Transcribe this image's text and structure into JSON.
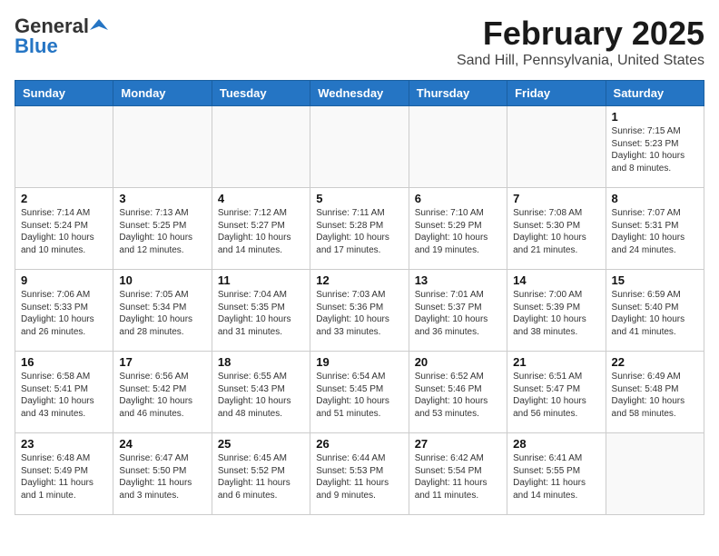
{
  "header": {
    "logo_general": "General",
    "logo_blue": "Blue",
    "title": "February 2025",
    "subtitle": "Sand Hill, Pennsylvania, United States"
  },
  "weekdays": [
    "Sunday",
    "Monday",
    "Tuesday",
    "Wednesday",
    "Thursday",
    "Friday",
    "Saturday"
  ],
  "weeks": [
    [
      {
        "day": "",
        "info": ""
      },
      {
        "day": "",
        "info": ""
      },
      {
        "day": "",
        "info": ""
      },
      {
        "day": "",
        "info": ""
      },
      {
        "day": "",
        "info": ""
      },
      {
        "day": "",
        "info": ""
      },
      {
        "day": "1",
        "info": "Sunrise: 7:15 AM\nSunset: 5:23 PM\nDaylight: 10 hours\nand 8 minutes."
      }
    ],
    [
      {
        "day": "2",
        "info": "Sunrise: 7:14 AM\nSunset: 5:24 PM\nDaylight: 10 hours\nand 10 minutes."
      },
      {
        "day": "3",
        "info": "Sunrise: 7:13 AM\nSunset: 5:25 PM\nDaylight: 10 hours\nand 12 minutes."
      },
      {
        "day": "4",
        "info": "Sunrise: 7:12 AM\nSunset: 5:27 PM\nDaylight: 10 hours\nand 14 minutes."
      },
      {
        "day": "5",
        "info": "Sunrise: 7:11 AM\nSunset: 5:28 PM\nDaylight: 10 hours\nand 17 minutes."
      },
      {
        "day": "6",
        "info": "Sunrise: 7:10 AM\nSunset: 5:29 PM\nDaylight: 10 hours\nand 19 minutes."
      },
      {
        "day": "7",
        "info": "Sunrise: 7:08 AM\nSunset: 5:30 PM\nDaylight: 10 hours\nand 21 minutes."
      },
      {
        "day": "8",
        "info": "Sunrise: 7:07 AM\nSunset: 5:31 PM\nDaylight: 10 hours\nand 24 minutes."
      }
    ],
    [
      {
        "day": "9",
        "info": "Sunrise: 7:06 AM\nSunset: 5:33 PM\nDaylight: 10 hours\nand 26 minutes."
      },
      {
        "day": "10",
        "info": "Sunrise: 7:05 AM\nSunset: 5:34 PM\nDaylight: 10 hours\nand 28 minutes."
      },
      {
        "day": "11",
        "info": "Sunrise: 7:04 AM\nSunset: 5:35 PM\nDaylight: 10 hours\nand 31 minutes."
      },
      {
        "day": "12",
        "info": "Sunrise: 7:03 AM\nSunset: 5:36 PM\nDaylight: 10 hours\nand 33 minutes."
      },
      {
        "day": "13",
        "info": "Sunrise: 7:01 AM\nSunset: 5:37 PM\nDaylight: 10 hours\nand 36 minutes."
      },
      {
        "day": "14",
        "info": "Sunrise: 7:00 AM\nSunset: 5:39 PM\nDaylight: 10 hours\nand 38 minutes."
      },
      {
        "day": "15",
        "info": "Sunrise: 6:59 AM\nSunset: 5:40 PM\nDaylight: 10 hours\nand 41 minutes."
      }
    ],
    [
      {
        "day": "16",
        "info": "Sunrise: 6:58 AM\nSunset: 5:41 PM\nDaylight: 10 hours\nand 43 minutes."
      },
      {
        "day": "17",
        "info": "Sunrise: 6:56 AM\nSunset: 5:42 PM\nDaylight: 10 hours\nand 46 minutes."
      },
      {
        "day": "18",
        "info": "Sunrise: 6:55 AM\nSunset: 5:43 PM\nDaylight: 10 hours\nand 48 minutes."
      },
      {
        "day": "19",
        "info": "Sunrise: 6:54 AM\nSunset: 5:45 PM\nDaylight: 10 hours\nand 51 minutes."
      },
      {
        "day": "20",
        "info": "Sunrise: 6:52 AM\nSunset: 5:46 PM\nDaylight: 10 hours\nand 53 minutes."
      },
      {
        "day": "21",
        "info": "Sunrise: 6:51 AM\nSunset: 5:47 PM\nDaylight: 10 hours\nand 56 minutes."
      },
      {
        "day": "22",
        "info": "Sunrise: 6:49 AM\nSunset: 5:48 PM\nDaylight: 10 hours\nand 58 minutes."
      }
    ],
    [
      {
        "day": "23",
        "info": "Sunrise: 6:48 AM\nSunset: 5:49 PM\nDaylight: 11 hours\nand 1 minute."
      },
      {
        "day": "24",
        "info": "Sunrise: 6:47 AM\nSunset: 5:50 PM\nDaylight: 11 hours\nand 3 minutes."
      },
      {
        "day": "25",
        "info": "Sunrise: 6:45 AM\nSunset: 5:52 PM\nDaylight: 11 hours\nand 6 minutes."
      },
      {
        "day": "26",
        "info": "Sunrise: 6:44 AM\nSunset: 5:53 PM\nDaylight: 11 hours\nand 9 minutes."
      },
      {
        "day": "27",
        "info": "Sunrise: 6:42 AM\nSunset: 5:54 PM\nDaylight: 11 hours\nand 11 minutes."
      },
      {
        "day": "28",
        "info": "Sunrise: 6:41 AM\nSunset: 5:55 PM\nDaylight: 11 hours\nand 14 minutes."
      },
      {
        "day": "",
        "info": ""
      }
    ]
  ]
}
